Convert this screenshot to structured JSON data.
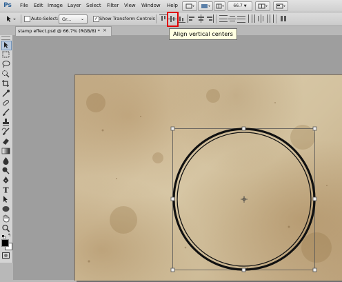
{
  "app": {
    "logo": "Ps"
  },
  "menu": [
    "File",
    "Edit",
    "Image",
    "Layer",
    "Select",
    "Filter",
    "View",
    "Window",
    "Help"
  ],
  "menubar_right": {
    "zoom": "66.7"
  },
  "options": {
    "auto_select_label": "Auto-Select:",
    "auto_select_value": "Gr...",
    "show_transform_label": "Show Transform Controls"
  },
  "tooltip": "Align vertical centers",
  "tab": {
    "title": "stamp effect.psd @ 66.7% (RGB/8) *",
    "close": "×"
  },
  "colors": {
    "highlight": "#e00000",
    "tooltip_bg": "#ffffe1",
    "paper": "#d3c29f"
  }
}
